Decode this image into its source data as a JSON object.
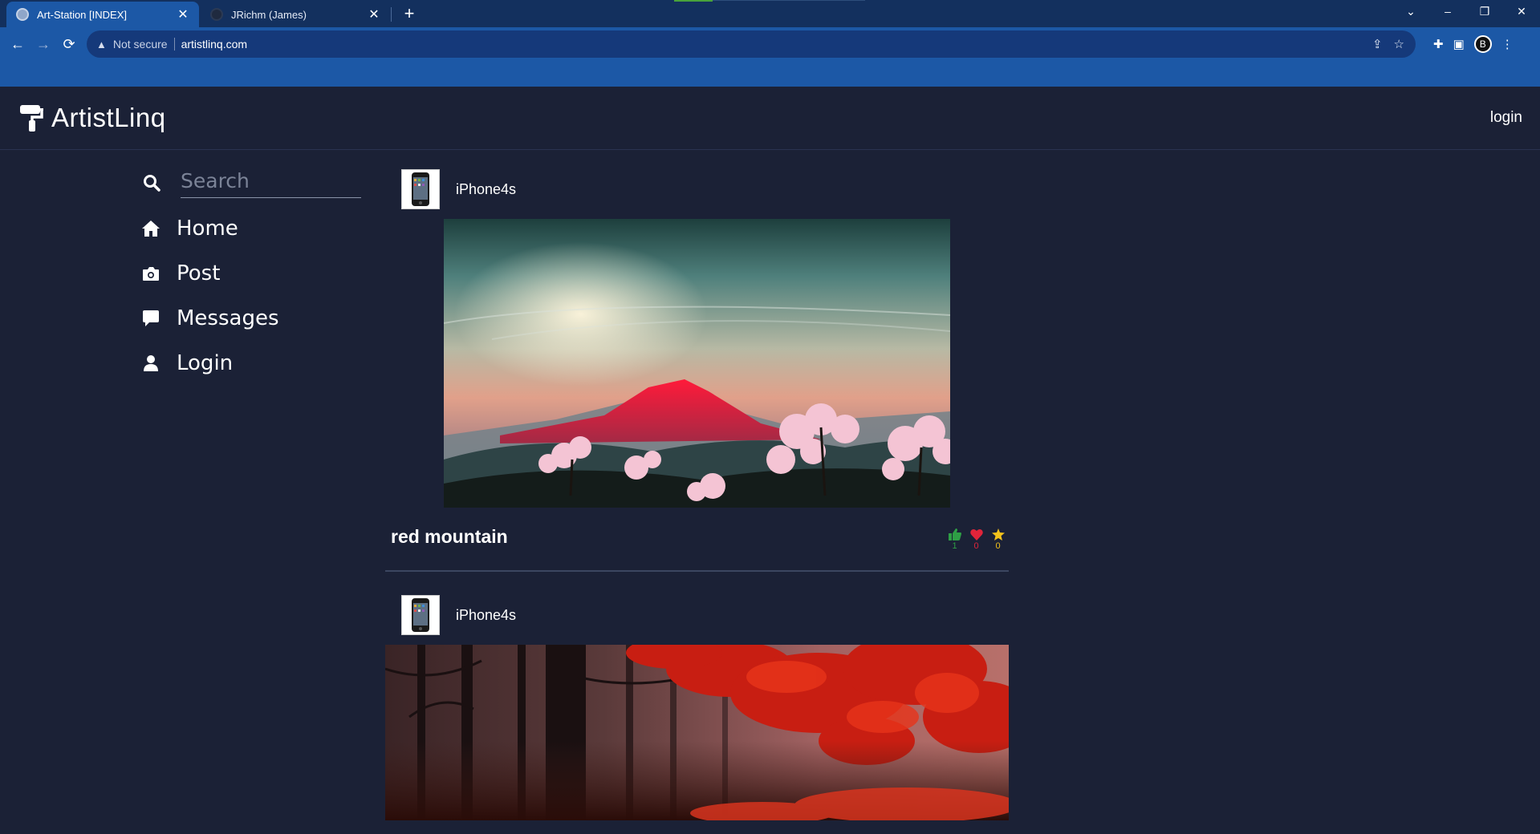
{
  "browser": {
    "tabs": [
      {
        "title": "Art-Station [INDEX]",
        "active": true
      },
      {
        "title": "JRichm (James)",
        "active": false
      }
    ],
    "new_tab_symbol": "+",
    "security_label": "Not secure",
    "url": "artistlinq.com",
    "profile_initial": "B"
  },
  "site": {
    "logo_text": "ArtistLinq",
    "header_login": "login"
  },
  "search": {
    "placeholder": "Search",
    "value": ""
  },
  "sidebar": {
    "items": [
      {
        "label": "Home",
        "icon": "home-icon"
      },
      {
        "label": "Post",
        "icon": "camera-icon"
      },
      {
        "label": "Messages",
        "icon": "message-icon"
      },
      {
        "label": "Login",
        "icon": "user-icon"
      }
    ]
  },
  "feed": {
    "posts": [
      {
        "username": "iPhone4s",
        "title": "red mountain",
        "image": "red-mountain-landscape",
        "reactions": {
          "likes": "1",
          "hearts": "0",
          "stars": "0"
        }
      },
      {
        "username": "iPhone4s",
        "title": "",
        "image": "red-forest"
      }
    ]
  },
  "colors": {
    "page_bg": "#1b2136",
    "titlebar": "#13305e",
    "toolbar": "#1c58a6",
    "like_green": "#2e9e45",
    "heart_red": "#e0243a",
    "star_yellow": "#f3c21b"
  }
}
